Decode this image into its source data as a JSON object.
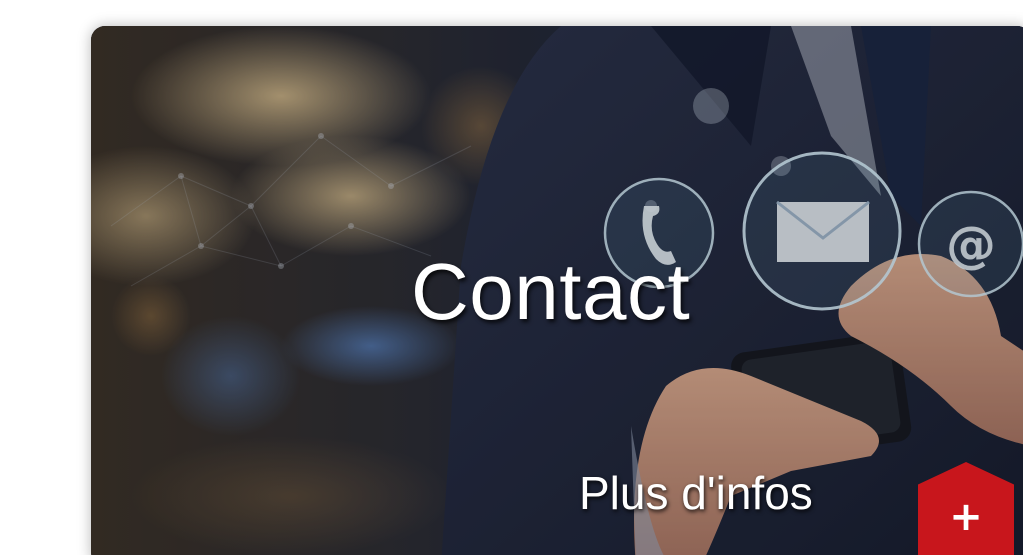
{
  "card": {
    "title": "Contact",
    "more_link_label": "Plus d'infos",
    "expand_button_glyph": "+",
    "image_icons": [
      "phone-icon",
      "envelope-icon",
      "at-sign-icon"
    ]
  },
  "colors": {
    "accent": "#c8161c",
    "text": "#ffffff"
  }
}
